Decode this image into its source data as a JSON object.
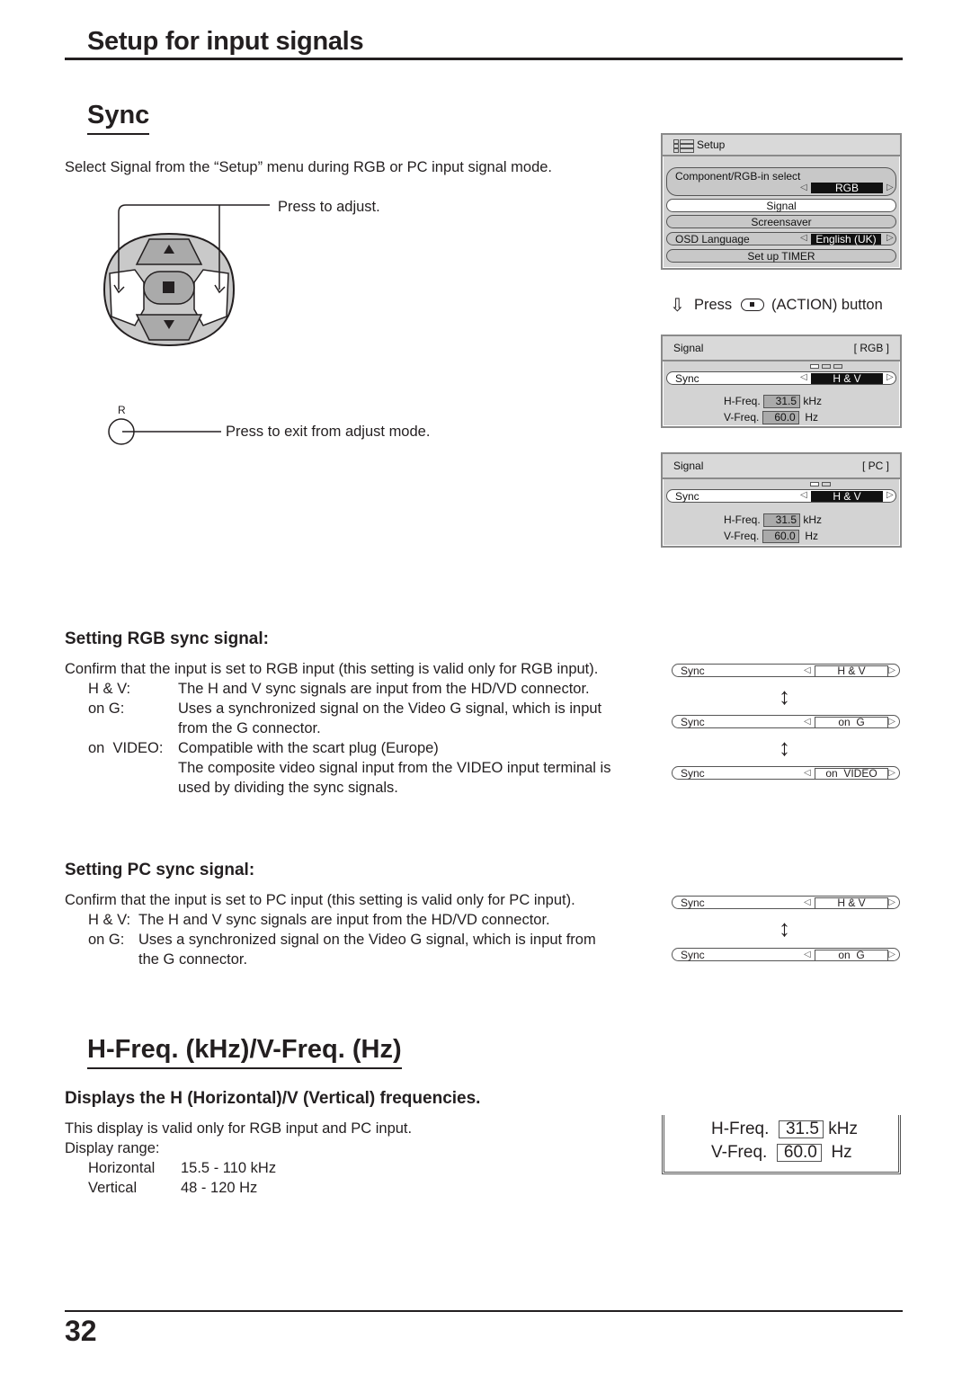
{
  "header": {
    "title": "Setup for input signals"
  },
  "sync_section": {
    "title": "Sync",
    "intro": "Select Signal from the “Setup” menu during RGB or PC input signal mode.",
    "press_to_adjust": "Press to adjust.",
    "r_button_label": "R",
    "press_to_exit": "Press to exit from adjust mode.",
    "action_caption": {
      "press": "Press",
      "button": "(ACTION) button"
    }
  },
  "setup_menu": {
    "title": "Setup",
    "items": [
      {
        "label": "Component/RGB-in  select",
        "value": "RGB"
      },
      {
        "label": "Signal",
        "selected": true
      },
      {
        "label": "Screensaver"
      },
      {
        "label": "OSD  Language",
        "value": "English (UK)"
      },
      {
        "label": "Set up TIMER"
      }
    ]
  },
  "signal_rgb_panel": {
    "title": "Signal",
    "mode": "[ RGB ]",
    "sync_label": "Sync",
    "sync_value": "H & V",
    "hfreq_label": "H-Freq.",
    "hfreq_value": "31.5",
    "hfreq_unit": "kHz",
    "vfreq_label": "V-Freq.",
    "vfreq_value": "60.0",
    "vfreq_unit": "Hz"
  },
  "signal_pc_panel": {
    "title": "Signal",
    "mode": "[ PC ]",
    "sync_label": "Sync",
    "sync_value": "H & V",
    "hfreq_label": "H-Freq.",
    "hfreq_value": "31.5",
    "hfreq_unit": "kHz",
    "vfreq_label": "V-Freq.",
    "vfreq_value": "60.0",
    "vfreq_unit": "Hz"
  },
  "rgb_sync": {
    "title": "Setting RGB sync signal:",
    "intro": "Confirm that the input is set to RGB input (this setting is valid only for RGB input).",
    "items": [
      {
        "term": "H & V:",
        "desc": "The H and V sync signals are input from the HD/VD connector."
      },
      {
        "term": "on G:",
        "desc": "Uses a synchronized signal on the Video G signal, which is input",
        "desc2": "from the G connector."
      },
      {
        "term": "on  VIDEO:",
        "desc": "Compatible with the scart plug (Europe)",
        "desc2": "The composite video signal input from the VIDEO input terminal is",
        "desc3": "used by dividing the sync signals."
      }
    ],
    "options": [
      "H & V",
      "on  G",
      "on  VIDEO"
    ],
    "row_label": "Sync"
  },
  "pc_sync": {
    "title": "Setting PC sync signal:",
    "intro": "Confirm that the input is set to PC input (this setting is valid only for PC input).",
    "items": [
      {
        "term": "H & V:",
        "desc": "The H and V sync signals are input from the HD/VD connector."
      },
      {
        "term": "on G:",
        "desc": "Uses a synchronized signal on the Video G signal, which is input from",
        "desc2": "the G connector."
      }
    ],
    "options": [
      "H & V",
      "on  G"
    ],
    "row_label": "Sync"
  },
  "freq_section": {
    "title": "H-Freq. (kHz)/V-Freq. (Hz)",
    "subtitle": "Displays the H (Horizontal)/V (Vertical) frequencies.",
    "line1": "This display is valid only for RGB input and PC input.",
    "line2": "Display range:",
    "ranges": [
      {
        "name": "Horizontal",
        "value": "15.5 - 110 kHz"
      },
      {
        "name": "Vertical",
        "value": "48 - 120 Hz"
      }
    ],
    "panel": {
      "hfreq_label": "H-Freq.",
      "hfreq_value": "31.5",
      "hfreq_unit": "kHz",
      "vfreq_label": "V-Freq.",
      "vfreq_value": "60.0",
      "vfreq_unit": "Hz"
    }
  },
  "footer": {
    "page_number": "32"
  }
}
